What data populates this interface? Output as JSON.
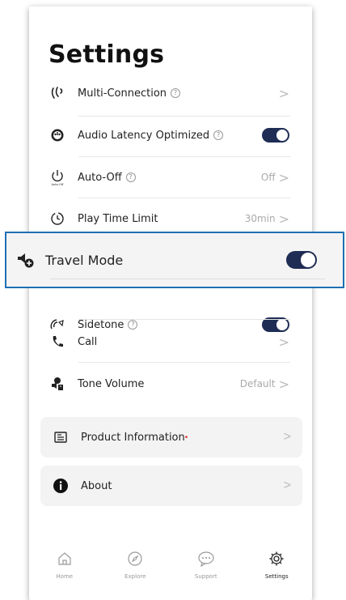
{
  "page": {
    "title": "Settings"
  },
  "settings": [
    {
      "label": "Multi-Connection",
      "info": "?",
      "value": "",
      "control": "chevron",
      "icon": "multi-connection-icon"
    },
    {
      "label": "Audio Latency Optimized",
      "info": "?",
      "value": "",
      "control": "toggle",
      "toggle_on": true,
      "icon": "audio-latency-icon"
    },
    {
      "label": "Auto-Off",
      "info": "?",
      "value": "Off",
      "control": "chevron",
      "icon": "auto-off-icon",
      "icon_caption": "Auto-Off"
    },
    {
      "label": "Play Time Limit",
      "info": "",
      "value": "30min",
      "control": "chevron",
      "icon": "timer-icon"
    },
    {
      "label": "Sidetone",
      "info": "?",
      "value": "",
      "control": "toggle",
      "toggle_on": true,
      "icon": "sidetone-icon"
    },
    {
      "label": "Call",
      "info": "",
      "value": "",
      "control": "chevron",
      "icon": "phone-icon"
    },
    {
      "label": "Tone Volume",
      "info": "",
      "value": "Default",
      "control": "chevron",
      "icon": "tone-volume-icon"
    }
  ],
  "highlight": {
    "label": "Travel Mode",
    "toggle_on": true,
    "icon": "travel-mode-icon",
    "border_color": "#1e6fb3"
  },
  "cards": [
    {
      "label": "Product Information",
      "badge": "•",
      "icon": "product-info-icon"
    },
    {
      "label": "About",
      "icon": "about-icon"
    }
  ],
  "chevron": ">",
  "tabs": [
    {
      "label": "Home",
      "icon": "home-icon",
      "active": false
    },
    {
      "label": "Explore",
      "icon": "compass-icon",
      "active": false
    },
    {
      "label": "Support",
      "icon": "chat-icon",
      "active": false
    },
    {
      "label": "Settings",
      "icon": "gear-icon",
      "active": true
    }
  ],
  "colors": {
    "toggle_on": "#1f2d55",
    "badge": "#e03030",
    "highlight_border": "#1e6fb3"
  }
}
